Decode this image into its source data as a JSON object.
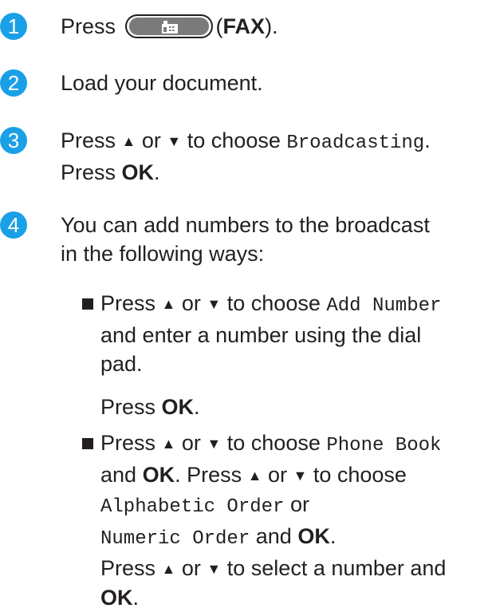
{
  "steps": [
    {
      "number": "1",
      "parts": {
        "press": "Press",
        "button_label": "(FAX)",
        "open": "(",
        "fax": "FAX",
        "close": ")."
      }
    },
    {
      "number": "2",
      "text": "Load your document."
    },
    {
      "number": "3",
      "press": "Press",
      "up": "▲",
      "or": "or",
      "down": "▼",
      "to_choose": "to choose",
      "option": "Broadcasting",
      "period": ".",
      "press2": "Press",
      "ok": "OK",
      "period2": "."
    },
    {
      "number": "4",
      "line1": "You can add numbers to the broadcast",
      "line2": "in the following ways:"
    }
  ],
  "bullets": [
    {
      "press": "Press",
      "up": "▲",
      "or": "or",
      "down": "▼",
      "to_choose": "to choose",
      "option": "Add Number",
      "line2": "and enter a number using the dial",
      "line3": "pad.",
      "press_ok_a": "Press",
      "ok": "OK",
      "period": "."
    },
    {
      "press": "Press",
      "up": "▲",
      "or": "or",
      "down": "▼",
      "to_choose": "to choose",
      "option": "Phone Book",
      "and": "and",
      "ok1": "OK",
      "mid": ". Press",
      "up2": "▲",
      "or2": "or",
      "down2": "▼",
      "to_choose2": "to choose",
      "opt_a": "Alphabetic Order",
      "or3": "or",
      "opt_b": "Numeric Order",
      "and2": "and",
      "ok2": "OK",
      "period2": ".",
      "press3": "Press",
      "up3": "▲",
      "or4": "or",
      "down3": "▼",
      "to_select": "to select a number and",
      "ok3": "OK",
      "period3": "."
    }
  ],
  "colors": {
    "step_circle": "#1aa0e6",
    "text": "#231f20"
  },
  "icons": {
    "fax_button": "fax-icon"
  }
}
